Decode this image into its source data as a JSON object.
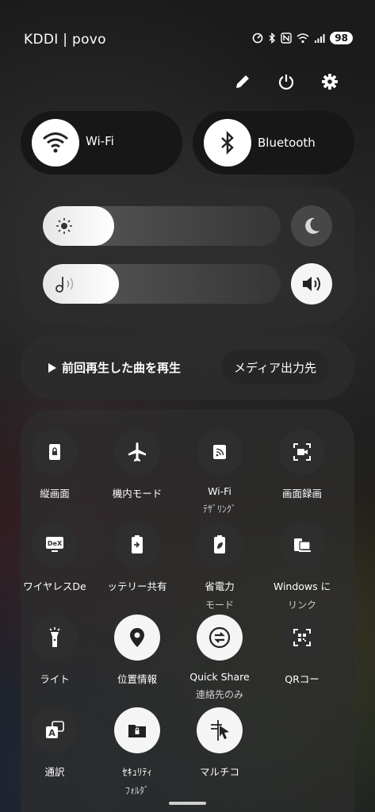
{
  "status_bar": {
    "carrier": "KDDI | povo",
    "battery": "98"
  },
  "connectivity": {
    "wifi": {
      "label": "Wi-Fi",
      "network": ""
    },
    "bluetooth": {
      "label": "Bluetooth"
    }
  },
  "media": {
    "play_label": "前回再生した曲を再生",
    "output_label": "メディア出力先"
  },
  "sliders": {
    "brightness_level": 0.3,
    "volume_level": 0.32
  },
  "tiles": [
    {
      "label": "縦画面",
      "sub": "",
      "icon": "portrait-lock-icon",
      "on": false
    },
    {
      "label": "機内モード",
      "sub": "",
      "icon": "airplane-icon",
      "on": false
    },
    {
      "label": "Wi-Fi",
      "sub": "ﾃｻﾞﾘﾝｸﾞ",
      "icon": "hotspot-icon",
      "on": false
    },
    {
      "label": "画面録画",
      "sub": "",
      "icon": "screen-record-icon",
      "on": false
    },
    {
      "label": "ワイヤレスDe",
      "sub": "",
      "icon": "dex-icon",
      "on": false
    },
    {
      "label": "ッテリー共有",
      "sub": "",
      "icon": "battery-share-icon",
      "on": false
    },
    {
      "label": "省電力",
      "sub": "モード",
      "icon": "power-saving-icon",
      "on": false
    },
    {
      "label": "Windows に",
      "sub": "リンク",
      "icon": "link-to-windows-icon",
      "on": false
    },
    {
      "label": "ライト",
      "sub": "",
      "icon": "flashlight-icon",
      "on": false
    },
    {
      "label": "位置情報",
      "sub": "",
      "icon": "location-icon",
      "on": true
    },
    {
      "label": "Quick Share",
      "sub": "連絡先のみ",
      "icon": "quick-share-icon",
      "on": true
    },
    {
      "label": "QRコー",
      "sub": "",
      "icon": "qr-code-icon",
      "on": false
    },
    {
      "label": "通訳",
      "sub": "",
      "icon": "interpreter-icon",
      "on": false
    },
    {
      "label": "ｾｷｭﾘﾃｨ",
      "sub": "ﾌｫﾙﾀﾞ",
      "icon": "secure-folder-icon",
      "on": true
    },
    {
      "label": "マルチコ",
      "sub": "",
      "icon": "multi-control-icon",
      "on": true
    }
  ]
}
